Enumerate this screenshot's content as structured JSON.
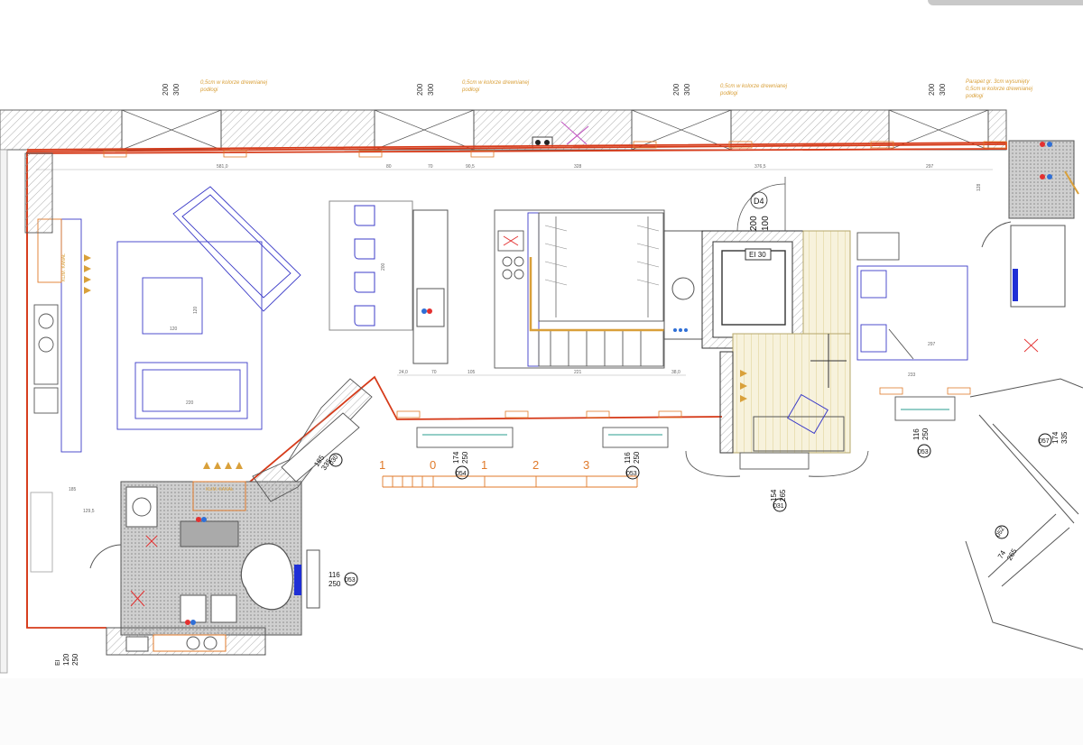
{
  "sheet": {
    "wall_notes": [
      "0,5cm w kolorze drewnianej",
      "podłogi",
      "0,5cm w kolorze drewnianej",
      "podłogi",
      "0,5cm w kolorze drewnianej",
      "podłogi",
      "Parapet gr. 3cm wysunięty",
      "0,5cm w kolorze drewnianej",
      "podłogi"
    ],
    "window_heights": {
      "a": "200",
      "b": "300"
    },
    "door_tag": {
      "id": "D4",
      "h1": "200",
      "h2": "100"
    },
    "fire_rating": "EI 30",
    "vent_labels": [
      "KLIM. KANAŁ",
      "KLIM. KANAŁ"
    ],
    "scale_bar": [
      "1",
      "0",
      "1",
      "2",
      "3"
    ],
    "window_tags": [
      {
        "w": "174",
        "h": "250",
        "code": "054"
      },
      {
        "w": "116",
        "h": "250",
        "code": "053"
      },
      {
        "w": "154",
        "h": "265",
        "code": "031"
      },
      {
        "w": "116",
        "h": "250",
        "code": "053"
      },
      {
        "w": "174",
        "h": "335",
        "code": "057"
      },
      {
        "w": "116",
        "h": "250",
        "code": "053"
      },
      {
        "w": "120",
        "h": "250",
        "code": "EI"
      },
      {
        "w": "74",
        "h": "265",
        "code": "052"
      },
      {
        "w": "185",
        "h": "335",
        "code": "030"
      }
    ],
    "dims_top": [
      "581,0",
      "80",
      "70",
      "90,5",
      "328",
      "376,5",
      "297"
    ],
    "dims_mid": [
      "24,0",
      "70",
      "105",
      "221",
      "38,0"
    ],
    "room_dims": [
      "120",
      "220",
      "120",
      "200",
      "185",
      "129,5",
      "297",
      "233",
      "128"
    ],
    "colors": {
      "wall": "#8c8c8c",
      "outline": "#d63b1a",
      "furniture": "#3c3cc8",
      "dimension": "#e07a2a",
      "annotation": "#d9a03a",
      "water_hot": "#e33030",
      "water_cold": "#2f6fd6"
    }
  }
}
